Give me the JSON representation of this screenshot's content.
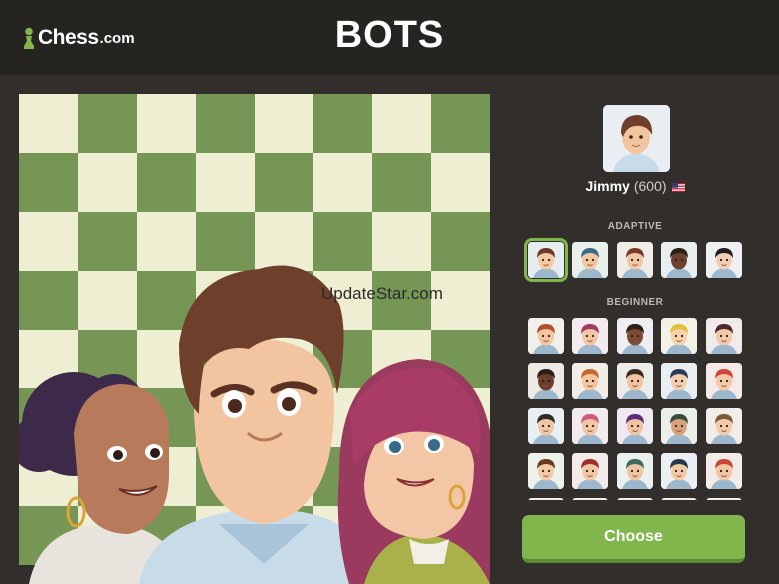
{
  "header": {
    "logo_brand": "Chess",
    "logo_tld": ".com",
    "title": "BOTS"
  },
  "board": {
    "watermark": "UpdateStar.com",
    "light_square_color": "#eeeed2",
    "dark_square_color": "#769656"
  },
  "selected_bot": {
    "name": "Jimmy",
    "rating": "(600)",
    "flag_icon": "us-flag-icon"
  },
  "sections": {
    "adaptive_label": "ADAPTIVE",
    "beginner_label": "BEGINNER"
  },
  "adaptive_bots": [
    {
      "skin": "#f6c9a3",
      "hair": "#6b3a26",
      "bg": "#e6ecef"
    },
    {
      "skin": "#f3c6a0",
      "hair": "#3b6b8a",
      "bg": "#eaf1ea"
    },
    {
      "skin": "#f2c7a5",
      "hair": "#7a3b2a",
      "bg": "#f0ece6"
    },
    {
      "skin": "#6b4330",
      "hair": "#2b2119",
      "bg": "#e8edf0"
    },
    {
      "skin": "#f1cfb2",
      "hair": "#1f1f1f",
      "bg": "#eef0f2"
    }
  ],
  "beginner_bots": [
    {
      "skin": "#f4c7a2",
      "hair": "#b5502e",
      "bg": "#f2f0ea"
    },
    {
      "skin": "#f1c6a4",
      "hair": "#a33a63",
      "bg": "#f4ebef"
    },
    {
      "skin": "#7a4a33",
      "hair": "#2a1f1a",
      "bg": "#efeef2"
    },
    {
      "skin": "#f5d2ad",
      "hair": "#e5c03a",
      "bg": "#f3f2e9"
    },
    {
      "skin": "#f1c8a9",
      "hair": "#4a2a2a",
      "bg": "#f1eaea"
    },
    {
      "skin": "#6a3f2b",
      "hair": "#2a1f1a",
      "bg": "#eee9e4"
    },
    {
      "skin": "#f3c5a1",
      "hair": "#c76a2e",
      "bg": "#f2ede6"
    },
    {
      "skin": "#f1c3a0",
      "hair": "#3a2a22",
      "bg": "#ecece8"
    },
    {
      "skin": "#f2cdb0",
      "hair": "#2b3a5a",
      "bg": "#e9eef3"
    },
    {
      "skin": "#f3c9a8",
      "hair": "#d0463b",
      "bg": "#f3e9e7"
    },
    {
      "skin": "#f1c6a2",
      "hair": "#2c2c2c",
      "bg": "#eaeff1"
    },
    {
      "skin": "#f2c7a6",
      "hair": "#d05a7a",
      "bg": "#f3ecef"
    },
    {
      "skin": "#f0c4a3",
      "hair": "#5a2f7a",
      "bg": "#efeaf2"
    },
    {
      "skin": "#d9a27a",
      "hair": "#3b4a3a",
      "bg": "#ecefe9"
    },
    {
      "skin": "#f3cba9",
      "hair": "#7a5a3a",
      "bg": "#f1eee8"
    },
    {
      "skin": "#f3c9a6",
      "hair": "#6a3a1e",
      "bg": "#eef1ea"
    },
    {
      "skin": "#f2c8a7",
      "hair": "#a32e2e",
      "bg": "#f3eaea"
    },
    {
      "skin": "#f1c5a2",
      "hair": "#3a6a5a",
      "bg": "#eaf1ee"
    },
    {
      "skin": "#f3caa8",
      "hair": "#2a3a4a",
      "bg": "#ebeef2"
    },
    {
      "skin": "#f2c6a4",
      "hair": "#c9463a",
      "bg": "#f2ebe7"
    },
    {
      "skin": "#f2c8a6",
      "hair": "#5a3a2a",
      "bg": "#efefef"
    },
    {
      "skin": "#f2c8a6",
      "hair": "#5a3a2a",
      "bg": "#efefef"
    },
    {
      "skin": "#f2c8a6",
      "hair": "#5a3a2a",
      "bg": "#efefef"
    },
    {
      "skin": "#f2c8a6",
      "hair": "#5a3a2a",
      "bg": "#efefef"
    },
    {
      "skin": "#f2c8a6",
      "hair": "#5a3a2a",
      "bg": "#efefef"
    }
  ],
  "choose_label": "Choose",
  "colors": {
    "accent_green": "#81b64c",
    "header_bg": "#262421",
    "page_bg": "#312e2b"
  }
}
